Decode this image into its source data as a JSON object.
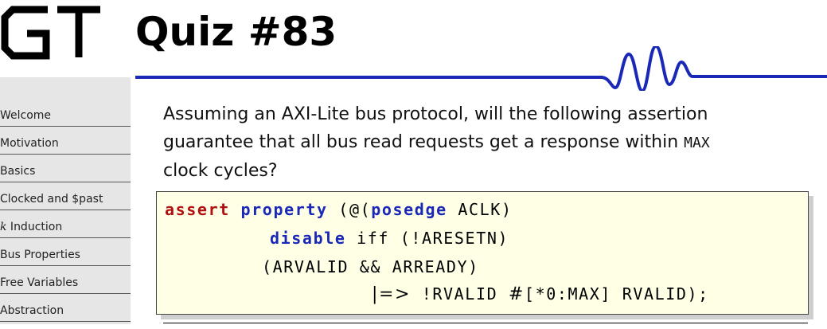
{
  "header": {
    "logo_text": "GT",
    "title": "Quiz #83",
    "accent_color": "#1a28b8"
  },
  "sidebar": {
    "background": "#e6e6e6",
    "items": [
      {
        "label": "Welcome"
      },
      {
        "label": "Motivation"
      },
      {
        "label": "Basics"
      },
      {
        "label": "Clocked and $past"
      },
      {
        "label": "k"
      },
      {
        "label": " Induction"
      },
      {
        "label": "Bus Properties"
      },
      {
        "label": "Free Variables"
      },
      {
        "label": "Abstraction"
      }
    ]
  },
  "question": {
    "part1": "Assuming an AXI-Lite bus protocol, will the following assertion",
    "part2": "guarantee that all bus read requests get a response within ",
    "max": "MAX",
    "part3": "clock cycles?"
  },
  "code": {
    "l1_assert": "assert",
    "l1_property": "property",
    "l1_rest_a": " (@(",
    "l1_posedge": "posedge",
    "l1_rest_b": " ACLK)",
    "l2_disable": "disable",
    "l2_rest": " iff (!ARESETN)",
    "l3": "(ARVALID && ARREADY)",
    "l4_impl": "|=>",
    "l4_a": " !RVALID ",
    "l4_hash": "#",
    "l4_b": "[*0:MAX] RVALID);"
  }
}
